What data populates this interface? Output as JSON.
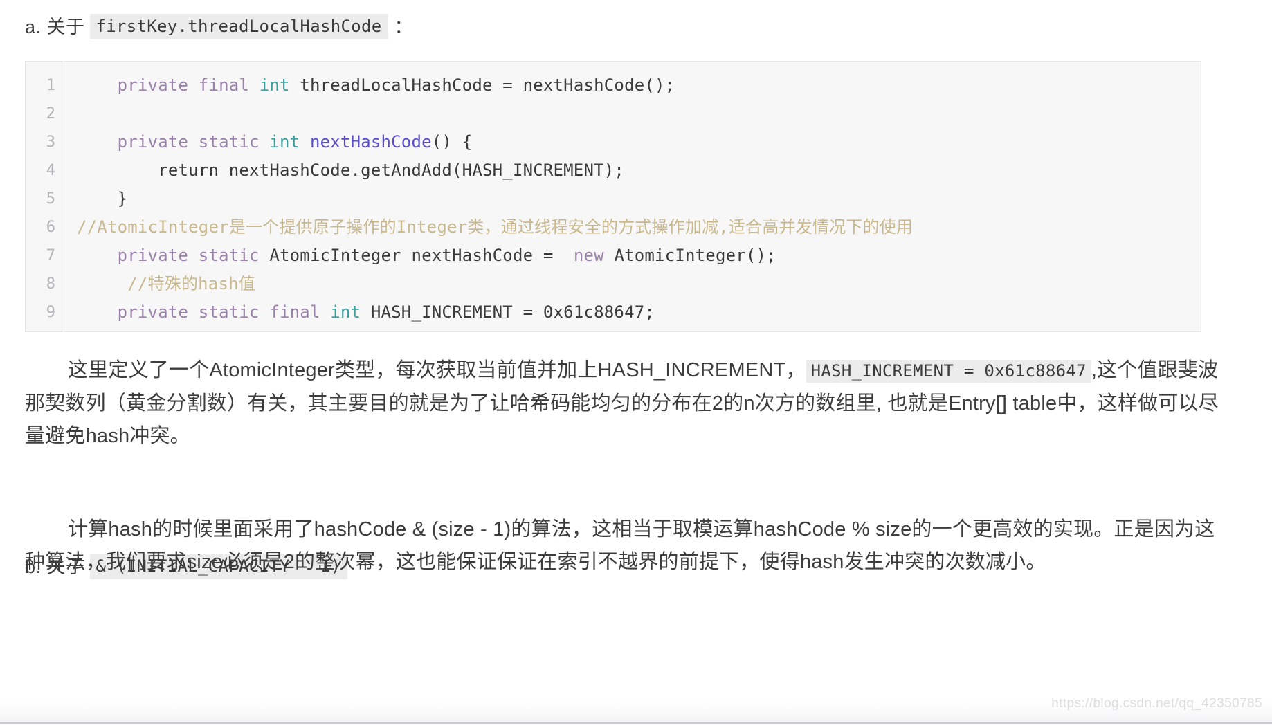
{
  "sections": {
    "a": {
      "prefix": "a. 关于",
      "chip": "firstKey.threadLocalHashCode",
      "suffix": "："
    },
    "b": {
      "prefix": "b. 关于",
      "chip": "& (INITIAL_CAPACITY - 1)",
      "suffix": ""
    }
  },
  "code_block": {
    "line_numbers": [
      "1",
      "2",
      "3",
      "4",
      "5",
      "6",
      "7",
      "8",
      "9"
    ],
    "lines": [
      {
        "number": "1",
        "tokens": [
          {
            "text": "    ",
            "type": "plain"
          },
          {
            "text": "private final ",
            "type": "keyword"
          },
          {
            "text": "int",
            "type": "type"
          },
          {
            "text": " threadLocalHashCode = nextHashCode();",
            "type": "plain"
          }
        ]
      },
      {
        "number": "2",
        "tokens": [
          {
            "text": "",
            "type": "plain"
          }
        ]
      },
      {
        "number": "3",
        "tokens": [
          {
            "text": "    ",
            "type": "plain"
          },
          {
            "text": "private static ",
            "type": "keyword"
          },
          {
            "text": "int",
            "type": "type"
          },
          {
            "text": " ",
            "type": "plain"
          },
          {
            "text": "nextHashCode",
            "type": "function"
          },
          {
            "text": "() {",
            "type": "plain"
          }
        ]
      },
      {
        "number": "4",
        "tokens": [
          {
            "text": "        return nextHashCode.getAndAdd(HASH_INCREMENT);",
            "type": "plain"
          }
        ]
      },
      {
        "number": "5",
        "tokens": [
          {
            "text": "    }",
            "type": "plain"
          }
        ]
      },
      {
        "number": "6",
        "tokens": [
          {
            "text": "//AtomicInteger是一个提供原子操作的Integer类，通过线程安全的方式操作加减,适合高并发情况下的使用",
            "type": "comment"
          }
        ]
      },
      {
        "number": "7",
        "tokens": [
          {
            "text": "    ",
            "type": "plain"
          },
          {
            "text": "private static ",
            "type": "keyword"
          },
          {
            "text": "AtomicInteger nextHashCode =  ",
            "type": "plain"
          },
          {
            "text": "new",
            "type": "keyword"
          },
          {
            "text": " AtomicInteger();",
            "type": "plain"
          }
        ]
      },
      {
        "number": "8",
        "tokens": [
          {
            "text": "     //特殊的hash值",
            "type": "comment"
          }
        ]
      },
      {
        "number": "9",
        "tokens": [
          {
            "text": "    ",
            "type": "plain"
          },
          {
            "text": "private static final ",
            "type": "keyword"
          },
          {
            "text": "int",
            "type": "type"
          },
          {
            "text": " HASH_INCREMENT = 0x61c88647;",
            "type": "plain"
          }
        ]
      }
    ]
  },
  "paragraphs": {
    "p1": {
      "part1": "这里定义了一个AtomicInteger类型，每次获取当前值并加上HASH_INCREMENT，",
      "chip": "HASH_INCREMENT = 0x61c88647",
      "part2": ",这个值跟斐波那契数列（黄金分割数）有关，其主要目的就是为了让哈希码能均匀的分布在2的n次方的数组里, 也就是Entry[] table中，这样做可以尽量避免hash冲突。"
    },
    "p2": {
      "text": "计算hash的时候里面采用了hashCode & (size - 1)的算法，这相当于取模运算hashCode % size的一个更高效的实现。正是因为这种算法，我们要求size必须是2的整次幂，这也能保证保证在索引不越界的前提下，使得hash发生冲突的次数减小。"
    }
  },
  "watermark": {
    "text": "https://blog.csdn.net/qq_42350785"
  },
  "colors": {
    "keyword": "#9b82ab",
    "type": "#3f9e9b",
    "function": "#5b4ecd",
    "comment": "#c9b98f",
    "plain": "#3a3a3a",
    "code_background": "#f7f7f8",
    "chip_background": "#ececec",
    "text": "#3d3d3d"
  }
}
